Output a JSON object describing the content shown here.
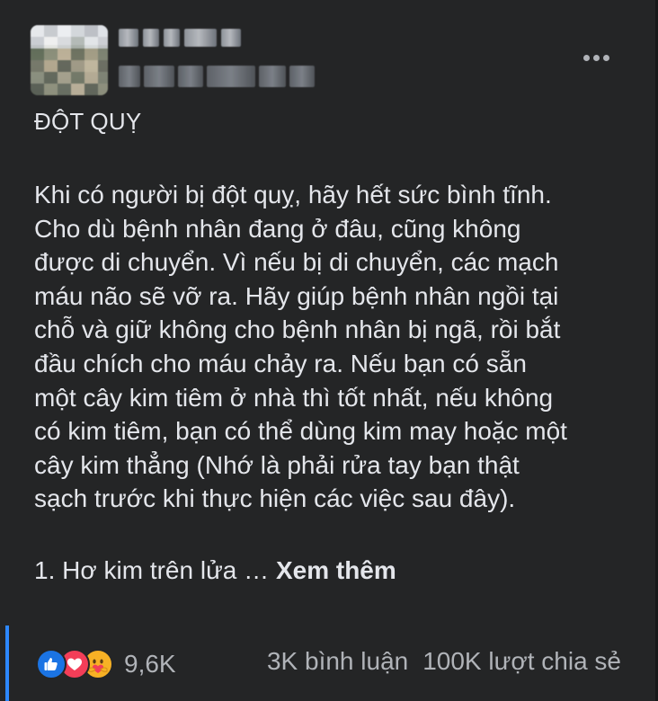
{
  "post": {
    "title": "ĐỘT QUỴ",
    "body": "Khi có người bị đột quỵ, hãy hết sức bình tĩnh.\nCho dù bệnh nhân đang ở đâu, cũng không\nđược di chuyển. Vì nếu bị di chuyển, các mạch\nmáu não sẽ vỡ ra. Hãy giúp bệnh nhân ngồi tại\nchỗ và giữ không cho bệnh nhân bị ngã, rồi bắt\nđầu chích cho máu chảy ra. Nếu bạn có sẵn\nmột cây kim tiêm ở nhà thì tốt nhất, nếu không\ncó kim tiêm, bạn có thể dùng kim may hoặc một\ncây kim thẳng (Nhớ là phải rửa tay bạn thật\nsạch trước khi thực hiện các việc sau đây).",
    "list_intro": "1. Hơ kim trên lửa …",
    "see_more": "Xem thêm"
  },
  "reactions": {
    "icons": [
      "like-icon",
      "love-icon",
      "care-icon"
    ],
    "count": "9,6K"
  },
  "engagement": {
    "comments": "3K bình luận",
    "shares": "100K lượt chia sẻ"
  },
  "colors": {
    "card_background": "#242526",
    "text": "#e4e6eb",
    "secondary_text": "#b0b3b8",
    "accent": "#2d88ff",
    "like": "#1b74e4",
    "love": "#f33e58",
    "care": "#f7b125"
  }
}
